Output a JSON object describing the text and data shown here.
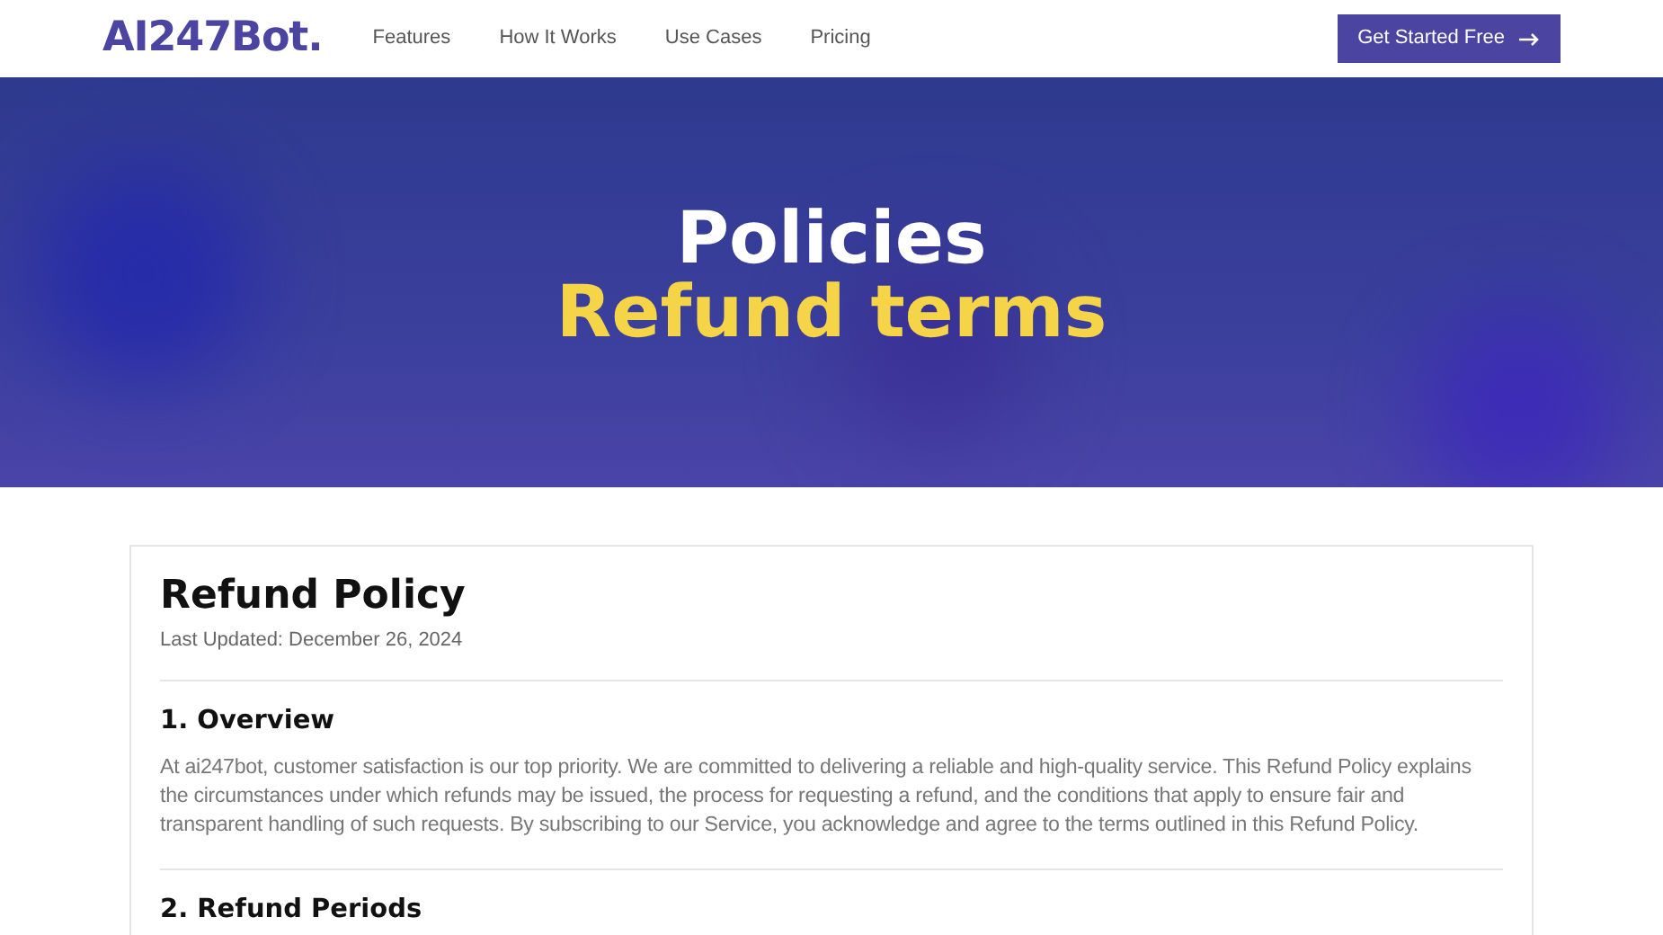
{
  "header": {
    "logo": "AI247Bot.",
    "nav": [
      {
        "label": "Features"
      },
      {
        "label": "How It Works"
      },
      {
        "label": "Use Cases"
      },
      {
        "label": "Pricing"
      }
    ],
    "cta": "Get Started Free"
  },
  "hero": {
    "title": "Policies",
    "subtitle": "Refund terms"
  },
  "document": {
    "title": "Refund Policy",
    "updated": "Last Updated: December 26, 2024",
    "sections": [
      {
        "heading": "1. Overview",
        "body": "At ai247bot, customer satisfaction is our top priority. We are committed to delivering a reliable and high-quality service. This Refund Policy explains the circumstances under which refunds may be issued, the process for requesting a refund, and the conditions that apply to ensure fair and transparent handling of such requests. By subscribing to our Service, you acknowledge and agree to the terms outlined in this Refund Policy."
      },
      {
        "heading": "2. Refund Periods"
      }
    ]
  }
}
